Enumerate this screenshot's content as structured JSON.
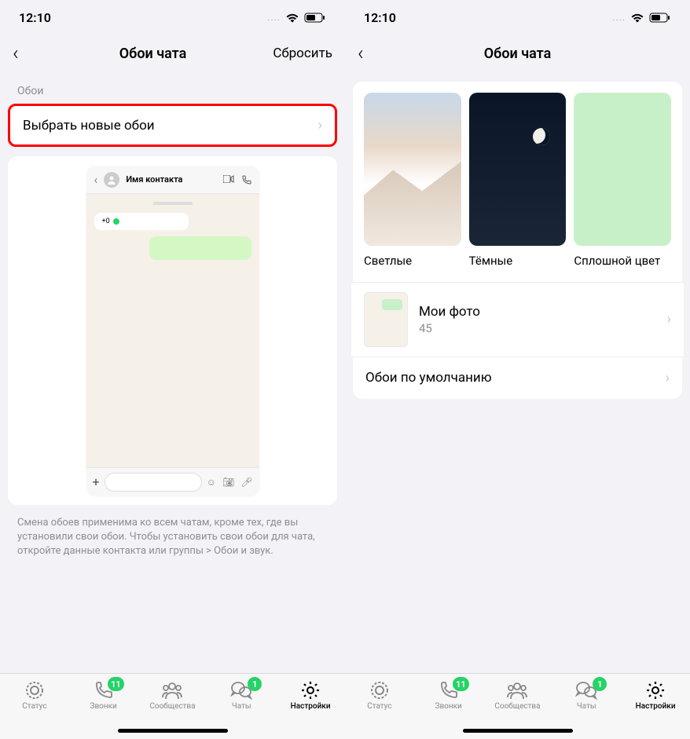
{
  "status": {
    "time": "12:10",
    "dots": "...."
  },
  "screen1": {
    "nav": {
      "title": "Обои чата",
      "action": "Сбросить"
    },
    "section_header": "Обои",
    "select_wallpaper": "Выбрать новые обои",
    "chat_preview": {
      "contact_name": "Имя контакта",
      "incoming_text": "+0"
    },
    "footer_text": "Смена обоев применима ко всем чатам, кроме тех, где вы установили свои обои. Чтобы установить свои обои для чата, откройте данные контакта или группы > Обои и звук."
  },
  "screen2": {
    "nav": {
      "title": "Обои чата"
    },
    "categories": {
      "light": "Светлые",
      "dark": "Тёмные",
      "solid": "Сплошной цвет"
    },
    "my_photos": {
      "title": "Мои фото",
      "count": "45"
    },
    "default_wallpaper": "Обои по умолчанию"
  },
  "tabs": {
    "status": {
      "label": "Статус"
    },
    "calls": {
      "label": "Звонки",
      "badge": "11"
    },
    "communities": {
      "label": "Сообщества"
    },
    "chats": {
      "label": "Чаты",
      "badge": "1"
    },
    "settings": {
      "label": "Настройки"
    }
  }
}
